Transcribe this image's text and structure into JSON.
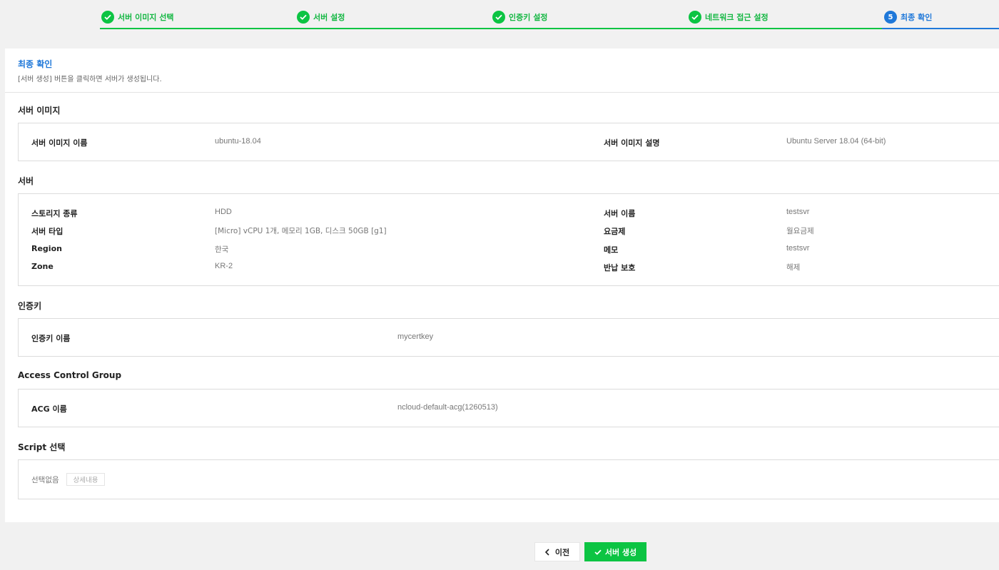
{
  "steps": [
    {
      "label": "서버 이미지 선택",
      "state": "done",
      "icon": "check-icon"
    },
    {
      "label": "서버 설정",
      "state": "done",
      "icon": "check-icon"
    },
    {
      "label": "인증키 설정",
      "state": "done",
      "icon": "check-icon"
    },
    {
      "label": "네트워크 접근 설정",
      "state": "done",
      "icon": "check-icon"
    },
    {
      "label": "최종 확인",
      "state": "current",
      "number": "5"
    }
  ],
  "colors": {
    "done": "#0cc443",
    "current": "#1f78d9"
  },
  "panel": {
    "title": "최종 확인",
    "description": "[서버 생성] 버튼을 클릭하면 서버가 생성됩니다."
  },
  "sections": {
    "server_image": {
      "title": "서버 이미지",
      "rows": [
        {
          "k1": "서버 이미지 이름",
          "v1": "ubuntu-18.04",
          "k2": "서버 이미지 설명",
          "v2": "Ubuntu Server 18.04 (64-bit)"
        }
      ]
    },
    "server": {
      "title": "서버",
      "rows": [
        {
          "k1": "스토리지 종류",
          "v1": "HDD",
          "k2": "서버 이름",
          "v2": "testsvr"
        },
        {
          "k1": "서버 타입",
          "v1": "[Micro] vCPU 1개, 메모리 1GB, 디스크 50GB [g1]",
          "k2": "요금제",
          "v2": "월요금제"
        },
        {
          "k1": "Region",
          "v1": "한국",
          "k2": "메모",
          "v2": "testsvr"
        },
        {
          "k1": "Zone",
          "v1": "KR-2",
          "k2": "반납 보호",
          "v2": "해제"
        }
      ]
    },
    "auth_key": {
      "title": "인증키",
      "key": "인증키 이름",
      "value": "mycertkey"
    },
    "acg": {
      "title": "Access Control Group",
      "key": "ACG 이름",
      "value": "ncloud-default-acg(1260513)"
    },
    "script": {
      "title": "Script 선택",
      "value": "선택없음",
      "detail_button": "상세내용"
    }
  },
  "buttons": {
    "prev": "이전",
    "prev_icon": "chevron-left-icon",
    "create": "서버 생성",
    "create_icon": "check-icon"
  }
}
